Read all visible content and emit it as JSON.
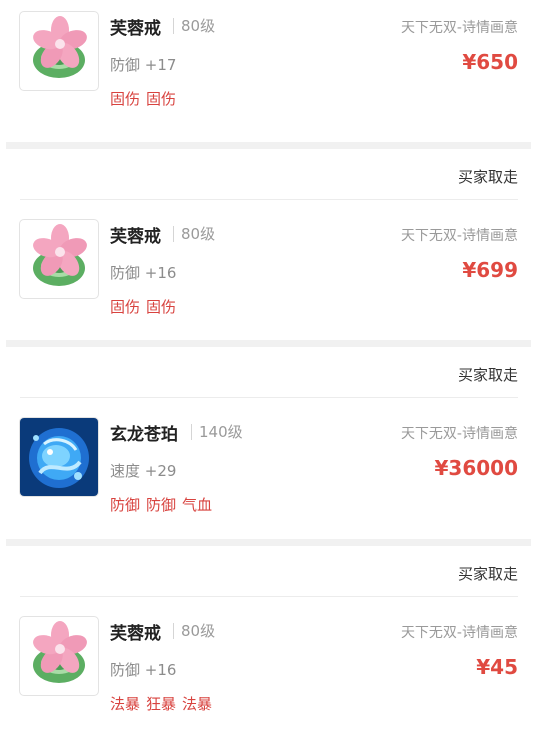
{
  "listings": [
    {
      "status": "",
      "icon": "pink-flower-jade-ring-icon",
      "name": "芙蓉戒",
      "level": "80级",
      "stat": "防御 +17",
      "tags": [
        "固伤",
        "固伤"
      ],
      "server": "天下无双-诗情画意",
      "price": "¥650"
    },
    {
      "status": "买家取走",
      "icon": "pink-flower-jade-ring-icon",
      "name": "芙蓉戒",
      "level": "80级",
      "stat": "防御 +16",
      "tags": [
        "固伤",
        "固伤"
      ],
      "server": "天下无双-诗情画意",
      "price": "¥699"
    },
    {
      "status": "买家取走",
      "icon": "blue-dragon-amber-icon",
      "name": "玄龙苍珀",
      "level": "140级",
      "stat": "速度 +29",
      "tags": [
        "防御",
        "防御",
        "气血"
      ],
      "server": "天下无双-诗情画意",
      "price": "¥36000"
    },
    {
      "status": "买家取走",
      "icon": "pink-flower-jade-ring-icon",
      "name": "芙蓉戒",
      "level": "80级",
      "stat": "防御 +16",
      "tags": [
        "法暴",
        "狂暴",
        "法暴"
      ],
      "server": "天下无双-诗情画意",
      "price": "¥45"
    }
  ],
  "colors": {
    "price": "#e04a41",
    "tag": "#d8433f",
    "separator_band": "#f1f1f1"
  }
}
